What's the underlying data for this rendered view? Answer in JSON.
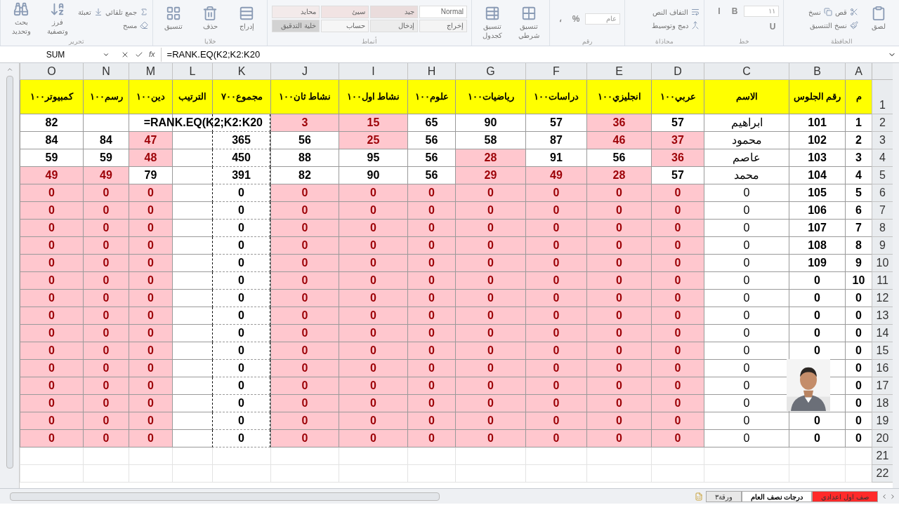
{
  "ribbon": {
    "groups": [
      {
        "label": "الحافظة",
        "items": [
          {
            "kind": "big",
            "label": "لصق"
          },
          {
            "kind": "small",
            "label": "قص"
          },
          {
            "kind": "small",
            "label": "نسخ"
          },
          {
            "kind": "small",
            "label": "نسخ التنسيق"
          }
        ]
      },
      {
        "label": "خط",
        "items": [
          {
            "kind": "field",
            "label": "١١"
          },
          {
            "kind": "letter",
            "label": "B"
          },
          {
            "kind": "letter",
            "label": "I"
          },
          {
            "kind": "letter",
            "label": "U"
          }
        ]
      },
      {
        "label": "محاذاة",
        "items": [
          {
            "kind": "small",
            "label": "التفاف النص"
          },
          {
            "kind": "small",
            "label": "دمج وتوسيط"
          }
        ]
      },
      {
        "label": "رقم",
        "items": [
          {
            "kind": "field",
            "label": "عام"
          },
          {
            "kind": "letter",
            "label": "%"
          },
          {
            "kind": "letter",
            "label": "،"
          }
        ]
      },
      {
        "items": [
          {
            "kind": "big",
            "label": "تنسيق شرطي"
          },
          {
            "kind": "big",
            "label": "تنسيق كجدول"
          }
        ]
      },
      {
        "label": "أنماط",
        "items": [
          {
            "kind": "style",
            "label": "Normal",
            "color": "#ffffff"
          },
          {
            "kind": "style",
            "label": "جيد",
            "color": "#eadcdc"
          },
          {
            "kind": "style",
            "label": "سيئ",
            "color": "#f1e3e3"
          },
          {
            "kind": "style",
            "label": "محايد",
            "color": "#f3eaea"
          },
          {
            "kind": "style",
            "label": "إخراج",
            "color": "#f4f4f4"
          },
          {
            "kind": "style",
            "label": "إدخال",
            "color": "#ececec"
          },
          {
            "kind": "style",
            "label": "حساب",
            "color": "#f6f6f6"
          },
          {
            "kind": "style",
            "label": "خلية التدقيق",
            "color": "#d2d2d2"
          }
        ]
      },
      {
        "label": "خلايا",
        "items": [
          {
            "kind": "big",
            "label": "إدراج"
          },
          {
            "kind": "big",
            "label": "حذف"
          },
          {
            "kind": "big",
            "label": "تنسيق"
          }
        ]
      },
      {
        "label": "تحرير",
        "items": [
          {
            "kind": "small",
            "label": "جمع تلقائي"
          },
          {
            "kind": "small",
            "label": "تعبئة"
          },
          {
            "kind": "small",
            "label": "مسح"
          },
          {
            "kind": "big",
            "label": "فرز وتصفية"
          },
          {
            "kind": "big",
            "label": "بحث وتحديد"
          }
        ]
      }
    ]
  },
  "formula_bar": {
    "name_box": "SUM",
    "fx": "fx",
    "formula": "=RANK.EQ(K2;K2:K20"
  },
  "columns": [
    {
      "letter": "A",
      "title": "م",
      "marquee": false
    },
    {
      "letter": "B",
      "title": "رقم الجلوس",
      "marquee": false
    },
    {
      "letter": "C",
      "title": "الاسم",
      "marquee": false
    },
    {
      "letter": "D",
      "title": "عربي١٠٠",
      "marquee": false
    },
    {
      "letter": "E",
      "title": "انجليزي١٠٠",
      "marquee": false
    },
    {
      "letter": "F",
      "title": "دراسات١٠٠",
      "marquee": false
    },
    {
      "letter": "G",
      "title": "رياضيات١٠٠",
      "marquee": false
    },
    {
      "letter": "H",
      "title": "علوم١٠٠",
      "marquee": false
    },
    {
      "letter": "I",
      "title": "نشاط اول١٠٠",
      "marquee": false
    },
    {
      "letter": "J",
      "title": "نشاط ثان١٠٠",
      "marquee": false
    },
    {
      "letter": "K",
      "title": "مجموع٧٠٠",
      "marquee": true
    },
    {
      "letter": "L",
      "title": "الترتيب",
      "marquee": false
    },
    {
      "letter": "M",
      "title": "دين١٠٠",
      "marquee": false
    },
    {
      "letter": "N",
      "title": "رسم١٠٠",
      "marquee": false
    },
    {
      "letter": "O",
      "title": "كمبيوتر١٠٠",
      "marquee": false
    }
  ],
  "header_row": "1",
  "rows": [
    {
      "row": "2",
      "cells": [
        {
          "v": "1",
          "low": false
        },
        {
          "v": "101",
          "low": false
        },
        {
          "v": "ابراهيم",
          "low": false
        },
        {
          "v": "57",
          "low": false
        },
        {
          "v": "36",
          "low": true
        },
        {
          "v": "57",
          "low": false
        },
        {
          "v": "90",
          "low": false
        },
        {
          "v": "65",
          "low": false
        },
        {
          "v": "15",
          "low": true
        },
        {
          "v": "3",
          "low": true
        },
        {
          "v": "=RANK.EQ(K2;K2:K20",
          "low": false,
          "kind": "formula"
        },
        {
          "low": false
        },
        {
          "low": false
        },
        {
          "low": false
        },
        {
          "v": "82",
          "low": false
        }
      ]
    },
    {
      "row": "3",
      "cells": [
        {
          "v": "2",
          "low": false
        },
        {
          "v": "102",
          "low": false
        },
        {
          "v": "محمود",
          "low": false
        },
        {
          "v": "37",
          "low": true
        },
        {
          "v": "46",
          "low": true
        },
        {
          "v": "87",
          "low": false
        },
        {
          "v": "58",
          "low": false
        },
        {
          "v": "56",
          "low": false
        },
        {
          "v": "25",
          "low": true
        },
        {
          "v": "56",
          "low": false
        },
        {
          "v": "365",
          "low": false
        },
        {
          "low": false
        },
        {
          "v": "47",
          "low": true
        },
        {
          "v": "84",
          "low": false
        },
        {
          "v": "84",
          "low": false
        }
      ]
    },
    {
      "row": "4",
      "cells": [
        {
          "v": "3",
          "low": false
        },
        {
          "v": "103",
          "low": false
        },
        {
          "v": "عاصم",
          "low": false
        },
        {
          "v": "36",
          "low": true
        },
        {
          "v": "56",
          "low": false
        },
        {
          "v": "91",
          "low": false
        },
        {
          "v": "28",
          "low": true
        },
        {
          "v": "56",
          "low": false
        },
        {
          "v": "95",
          "low": false
        },
        {
          "v": "88",
          "low": false
        },
        {
          "v": "450",
          "low": false
        },
        {
          "low": false
        },
        {
          "v": "48",
          "low": true
        },
        {
          "v": "59",
          "low": false
        },
        {
          "v": "59",
          "low": false
        }
      ]
    },
    {
      "row": "5",
      "cells": [
        {
          "v": "4",
          "low": false
        },
        {
          "v": "104",
          "low": false
        },
        {
          "v": "محمد",
          "low": false
        },
        {
          "v": "57",
          "low": false
        },
        {
          "v": "28",
          "low": true
        },
        {
          "v": "49",
          "low": true
        },
        {
          "v": "29",
          "low": true
        },
        {
          "v": "56",
          "low": false
        },
        {
          "v": "90",
          "low": false
        },
        {
          "v": "82",
          "low": false
        },
        {
          "v": "391",
          "low": false
        },
        {
          "low": false
        },
        {
          "v": "79",
          "low": false
        },
        {
          "v": "49",
          "low": true
        },
        {
          "v": "49",
          "low": true
        }
      ]
    },
    {
      "row": "6",
      "cells": [
        {
          "v": "5",
          "low": false
        },
        {
          "v": "105",
          "low": false
        },
        {
          "v": "0",
          "low": false
        },
        {
          "v": "0",
          "low": true
        },
        {
          "v": "0",
          "low": true
        },
        {
          "v": "0",
          "low": true
        },
        {
          "v": "0",
          "low": true
        },
        {
          "v": "0",
          "low": true
        },
        {
          "v": "0",
          "low": true
        },
        {
          "v": "0",
          "low": true
        },
        {
          "v": "0",
          "low": false
        },
        {
          "low": false
        },
        {
          "v": "0",
          "low": true
        },
        {
          "v": "0",
          "low": true
        },
        {
          "v": "0",
          "low": true
        }
      ]
    },
    {
      "row": "7",
      "cells": [
        {
          "v": "6",
          "low": false
        },
        {
          "v": "106",
          "low": false
        },
        {
          "v": "0",
          "low": false
        },
        {
          "v": "0",
          "low": true
        },
        {
          "v": "0",
          "low": true
        },
        {
          "v": "0",
          "low": true
        },
        {
          "v": "0",
          "low": true
        },
        {
          "v": "0",
          "low": true
        },
        {
          "v": "0",
          "low": true
        },
        {
          "v": "0",
          "low": true
        },
        {
          "v": "0",
          "low": false
        },
        {
          "low": false
        },
        {
          "v": "0",
          "low": true
        },
        {
          "v": "0",
          "low": true
        },
        {
          "v": "0",
          "low": true
        }
      ]
    },
    {
      "row": "8",
      "cells": [
        {
          "v": "7",
          "low": false
        },
        {
          "v": "107",
          "low": false
        },
        {
          "v": "0",
          "low": false
        },
        {
          "v": "0",
          "low": true
        },
        {
          "v": "0",
          "low": true
        },
        {
          "v": "0",
          "low": true
        },
        {
          "v": "0",
          "low": true
        },
        {
          "v": "0",
          "low": true
        },
        {
          "v": "0",
          "low": true
        },
        {
          "v": "0",
          "low": true
        },
        {
          "v": "0",
          "low": false
        },
        {
          "low": false
        },
        {
          "v": "0",
          "low": true
        },
        {
          "v": "0",
          "low": true
        },
        {
          "v": "0",
          "low": true
        }
      ]
    },
    {
      "row": "9",
      "cells": [
        {
          "v": "8",
          "low": false
        },
        {
          "v": "108",
          "low": false
        },
        {
          "v": "0",
          "low": false
        },
        {
          "v": "0",
          "low": true
        },
        {
          "v": "0",
          "low": true
        },
        {
          "v": "0",
          "low": true
        },
        {
          "v": "0",
          "low": true
        },
        {
          "v": "0",
          "low": true
        },
        {
          "v": "0",
          "low": true
        },
        {
          "v": "0",
          "low": true
        },
        {
          "v": "0",
          "low": false
        },
        {
          "low": false
        },
        {
          "v": "0",
          "low": true
        },
        {
          "v": "0",
          "low": true
        },
        {
          "v": "0",
          "low": true
        }
      ]
    },
    {
      "row": "10",
      "cells": [
        {
          "v": "9",
          "low": false
        },
        {
          "v": "109",
          "low": false
        },
        {
          "v": "0",
          "low": false
        },
        {
          "v": "0",
          "low": true
        },
        {
          "v": "0",
          "low": true
        },
        {
          "v": "0",
          "low": true
        },
        {
          "v": "0",
          "low": true
        },
        {
          "v": "0",
          "low": true
        },
        {
          "v": "0",
          "low": true
        },
        {
          "v": "0",
          "low": true
        },
        {
          "v": "0",
          "low": false
        },
        {
          "low": false
        },
        {
          "v": "0",
          "low": true
        },
        {
          "v": "0",
          "low": true
        },
        {
          "v": "0",
          "low": true
        }
      ]
    },
    {
      "row": "11",
      "cells": [
        {
          "v": "10",
          "low": false
        },
        {
          "v": "0",
          "low": false
        },
        {
          "v": "0",
          "low": false
        },
        {
          "v": "0",
          "low": true
        },
        {
          "v": "0",
          "low": true
        },
        {
          "v": "0",
          "low": true
        },
        {
          "v": "0",
          "low": true
        },
        {
          "v": "0",
          "low": true
        },
        {
          "v": "0",
          "low": true
        },
        {
          "v": "0",
          "low": true
        },
        {
          "v": "0",
          "low": false
        },
        {
          "low": false
        },
        {
          "v": "0",
          "low": true
        },
        {
          "v": "0",
          "low": true
        },
        {
          "v": "0",
          "low": true
        }
      ]
    },
    {
      "row": "12",
      "cells": [
        {
          "v": "0",
          "low": false
        },
        {
          "v": "0",
          "low": false
        },
        {
          "v": "0",
          "low": false
        },
        {
          "v": "0",
          "low": true
        },
        {
          "v": "0",
          "low": true
        },
        {
          "v": "0",
          "low": true
        },
        {
          "v": "0",
          "low": true
        },
        {
          "v": "0",
          "low": true
        },
        {
          "v": "0",
          "low": true
        },
        {
          "v": "0",
          "low": true
        },
        {
          "v": "0",
          "low": false
        },
        {
          "low": false
        },
        {
          "v": "0",
          "low": true
        },
        {
          "v": "0",
          "low": true
        },
        {
          "v": "0",
          "low": true
        }
      ]
    },
    {
      "row": "13",
      "cells": [
        {
          "v": "0",
          "low": false
        },
        {
          "v": "0",
          "low": false
        },
        {
          "v": "0",
          "low": false
        },
        {
          "v": "0",
          "low": true
        },
        {
          "v": "0",
          "low": true
        },
        {
          "v": "0",
          "low": true
        },
        {
          "v": "0",
          "low": true
        },
        {
          "v": "0",
          "low": true
        },
        {
          "v": "0",
          "low": true
        },
        {
          "v": "0",
          "low": true
        },
        {
          "v": "0",
          "low": false
        },
        {
          "low": false
        },
        {
          "v": "0",
          "low": true
        },
        {
          "v": "0",
          "low": true
        },
        {
          "v": "0",
          "low": true
        }
      ]
    },
    {
      "row": "14",
      "cells": [
        {
          "v": "0",
          "low": false
        },
        {
          "v": "0",
          "low": false
        },
        {
          "v": "0",
          "low": false
        },
        {
          "v": "0",
          "low": true
        },
        {
          "v": "0",
          "low": true
        },
        {
          "v": "0",
          "low": true
        },
        {
          "v": "0",
          "low": true
        },
        {
          "v": "0",
          "low": true
        },
        {
          "v": "0",
          "low": true
        },
        {
          "v": "0",
          "low": true
        },
        {
          "v": "0",
          "low": false
        },
        {
          "low": false
        },
        {
          "v": "0",
          "low": true
        },
        {
          "v": "0",
          "low": true
        },
        {
          "v": "0",
          "low": true
        }
      ]
    },
    {
      "row": "15",
      "cells": [
        {
          "v": "0",
          "low": false
        },
        {
          "v": "0",
          "low": false
        },
        {
          "v": "0",
          "low": false
        },
        {
          "v": "0",
          "low": true
        },
        {
          "v": "0",
          "low": true
        },
        {
          "v": "0",
          "low": true
        },
        {
          "v": "0",
          "low": true
        },
        {
          "v": "0",
          "low": true
        },
        {
          "v": "0",
          "low": true
        },
        {
          "v": "0",
          "low": true
        },
        {
          "v": "0",
          "low": false
        },
        {
          "low": false
        },
        {
          "v": "0",
          "low": true
        },
        {
          "v": "0",
          "low": true
        },
        {
          "v": "0",
          "low": true
        }
      ]
    },
    {
      "row": "16",
      "cells": [
        {
          "v": "0",
          "low": false
        },
        {
          "low": false
        },
        {
          "v": "0",
          "low": false
        },
        {
          "v": "0",
          "low": true
        },
        {
          "v": "0",
          "low": true
        },
        {
          "v": "0",
          "low": true
        },
        {
          "v": "0",
          "low": true
        },
        {
          "v": "0",
          "low": true
        },
        {
          "v": "0",
          "low": true
        },
        {
          "v": "0",
          "low": true
        },
        {
          "v": "0",
          "low": false
        },
        {
          "low": false
        },
        {
          "v": "0",
          "low": true
        },
        {
          "v": "0",
          "low": true
        },
        {
          "v": "0",
          "low": true
        }
      ]
    },
    {
      "row": "17",
      "cells": [
        {
          "v": "0",
          "low": false
        },
        {
          "low": false
        },
        {
          "v": "0",
          "low": false
        },
        {
          "v": "0",
          "low": true
        },
        {
          "v": "0",
          "low": true
        },
        {
          "v": "0",
          "low": true
        },
        {
          "v": "0",
          "low": true
        },
        {
          "v": "0",
          "low": true
        },
        {
          "v": "0",
          "low": true
        },
        {
          "v": "0",
          "low": true
        },
        {
          "v": "0",
          "low": false
        },
        {
          "low": false
        },
        {
          "v": "0",
          "low": true
        },
        {
          "v": "0",
          "low": true
        },
        {
          "v": "0",
          "low": true
        }
      ]
    },
    {
      "row": "18",
      "cells": [
        {
          "v": "0",
          "low": false
        },
        {
          "low": false
        },
        {
          "v": "0",
          "low": false
        },
        {
          "v": "0",
          "low": true
        },
        {
          "v": "0",
          "low": true
        },
        {
          "v": "0",
          "low": true
        },
        {
          "v": "0",
          "low": true
        },
        {
          "v": "0",
          "low": true
        },
        {
          "v": "0",
          "low": true
        },
        {
          "v": "0",
          "low": true
        },
        {
          "v": "0",
          "low": false
        },
        {
          "low": false
        },
        {
          "v": "0",
          "low": true
        },
        {
          "v": "0",
          "low": true
        },
        {
          "v": "0",
          "low": true
        }
      ]
    },
    {
      "row": "19",
      "cells": [
        {
          "v": "0",
          "low": false
        },
        {
          "v": "0",
          "low": false
        },
        {
          "v": "0",
          "low": false
        },
        {
          "v": "0",
          "low": true
        },
        {
          "v": "0",
          "low": true
        },
        {
          "v": "0",
          "low": true
        },
        {
          "v": "0",
          "low": true
        },
        {
          "v": "0",
          "low": true
        },
        {
          "v": "0",
          "low": true
        },
        {
          "v": "0",
          "low": true
        },
        {
          "v": "0",
          "low": false
        },
        {
          "low": false
        },
        {
          "v": "0",
          "low": true
        },
        {
          "v": "0",
          "low": true
        },
        {
          "v": "0",
          "low": true
        }
      ]
    },
    {
      "row": "20",
      "cells": [
        {
          "v": "0",
          "low": false
        },
        {
          "v": "0",
          "low": false
        },
        {
          "v": "0",
          "low": false
        },
        {
          "v": "0",
          "low": true
        },
        {
          "v": "0",
          "low": true
        },
        {
          "v": "0",
          "low": true
        },
        {
          "v": "0",
          "low": true
        },
        {
          "v": "0",
          "low": true
        },
        {
          "v": "0",
          "low": true
        },
        {
          "v": "0",
          "low": true
        },
        {
          "v": "0",
          "low": false
        },
        {
          "low": false
        },
        {
          "v": "0",
          "low": true
        },
        {
          "v": "0",
          "low": true
        },
        {
          "v": "0",
          "low": true
        }
      ]
    }
  ],
  "empty_rows": [
    "21",
    "22"
  ],
  "sheet_tabs": [
    {
      "label": "صف اول اعدادي",
      "selected": false,
      "color": "#ff2a2a"
    },
    {
      "label": "درجات نصف العام",
      "selected": true,
      "color": "#ffffff"
    },
    {
      "label": "ورقة٣",
      "selected": false,
      "color": "#e8e8e8"
    }
  ]
}
